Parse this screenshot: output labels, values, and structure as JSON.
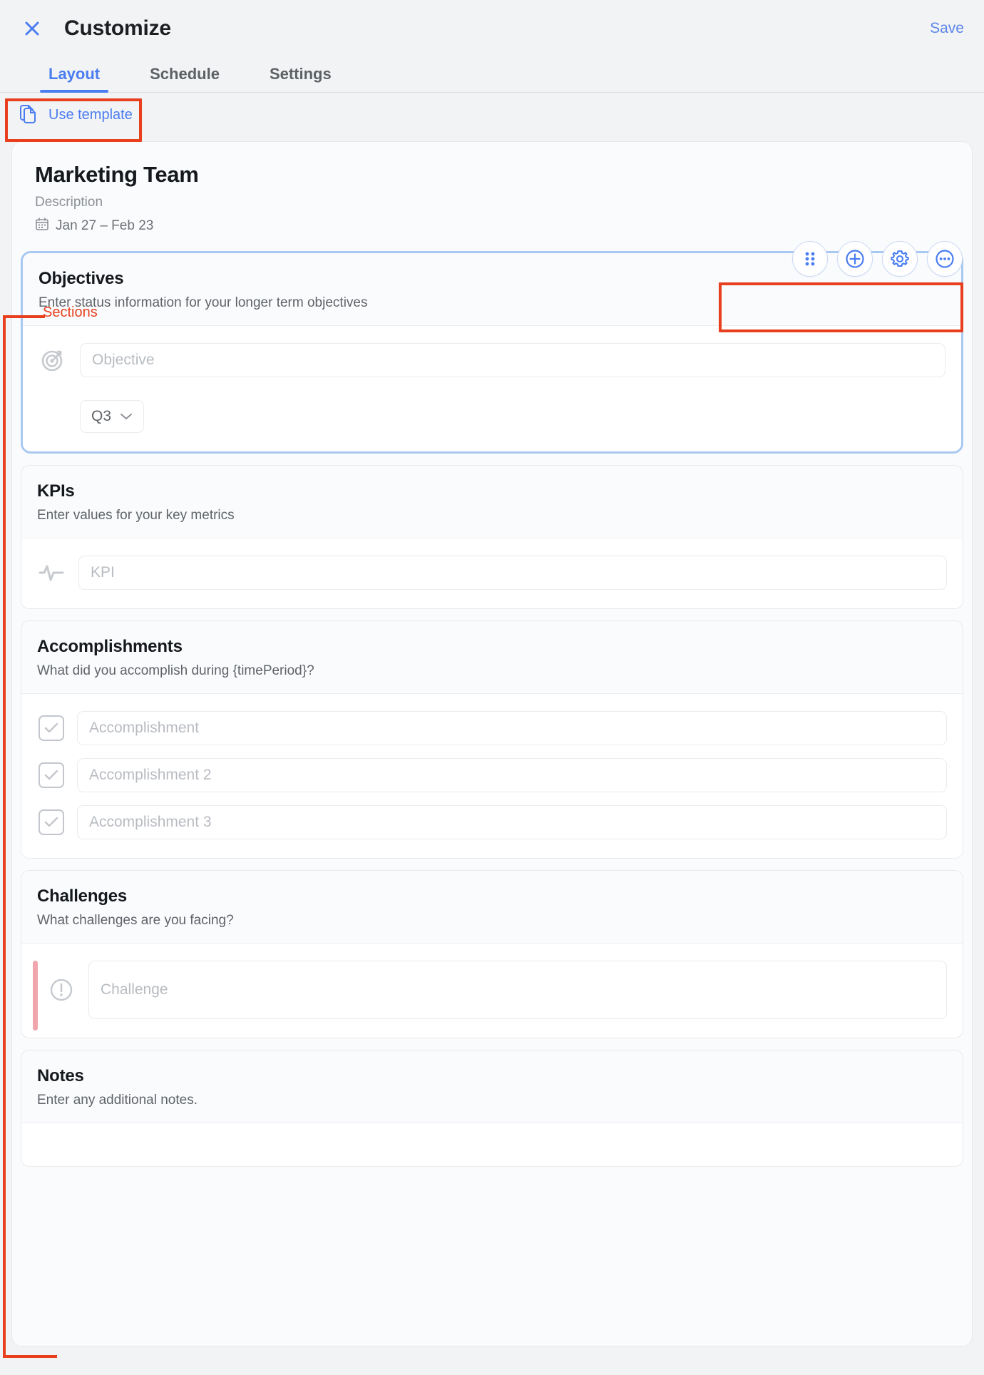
{
  "header": {
    "close_icon": "close-icon",
    "title": "Customize",
    "save_label": "Save"
  },
  "tabs": [
    {
      "label": "Layout",
      "active": true
    },
    {
      "label": "Schedule",
      "active": false
    },
    {
      "label": "Settings",
      "active": false
    }
  ],
  "template_button": {
    "label": "Use template",
    "icon": "copy-document-icon"
  },
  "card": {
    "title": "Marketing Team",
    "description": "Description",
    "date_range": "Jan 27 – Feb 23",
    "calendar_icon": "calendar-icon"
  },
  "section_toolbar": [
    {
      "name": "drag-handle-icon",
      "label": "Drag"
    },
    {
      "name": "plus-circle-icon",
      "label": "Add"
    },
    {
      "name": "gear-icon",
      "label": "Settings"
    },
    {
      "name": "ellipsis-icon",
      "label": "More"
    }
  ],
  "annotations": {
    "sections_label": "Sections"
  },
  "sections": [
    {
      "title": "Objectives",
      "subtitle": "Enter status information for your longer term objectives",
      "selected": true,
      "icon": "target-icon",
      "fields": [
        {
          "placeholder": "Objective",
          "value": ""
        }
      ],
      "quarter": {
        "value": "Q3",
        "chevron_icon": "chevron-down-icon"
      }
    },
    {
      "title": "KPIs",
      "subtitle": "Enter values for your key metrics",
      "selected": false,
      "icon": "activity-pulse-icon",
      "fields": [
        {
          "placeholder": "KPI",
          "value": ""
        }
      ]
    },
    {
      "title": "Accomplishments",
      "subtitle": "What did you accomplish during {timePeriod}?",
      "selected": false,
      "icon": "checkbox-icon",
      "fields": [
        {
          "placeholder": "Accomplishment",
          "value": ""
        },
        {
          "placeholder": "Accomplishment 2",
          "value": ""
        },
        {
          "placeholder": "Accomplishment 3",
          "value": ""
        }
      ]
    },
    {
      "title": "Challenges",
      "subtitle": "What challenges are you facing?",
      "selected": false,
      "icon": "alert-circle-icon",
      "accent_color": "#efa6ad",
      "fields": [
        {
          "placeholder": "Challenge",
          "value": ""
        }
      ]
    },
    {
      "title": "Notes",
      "subtitle": "Enter any additional notes.",
      "selected": false,
      "icon": "note-icon",
      "fields": []
    }
  ],
  "colors": {
    "accent_blue": "#4a7df0",
    "link_blue": "#5b85ec",
    "annotation_red": "#e8401f",
    "selected_border": "#a9c8f2",
    "challenge_accent": "#efa6ad",
    "page_background": "#f2f3f5"
  }
}
